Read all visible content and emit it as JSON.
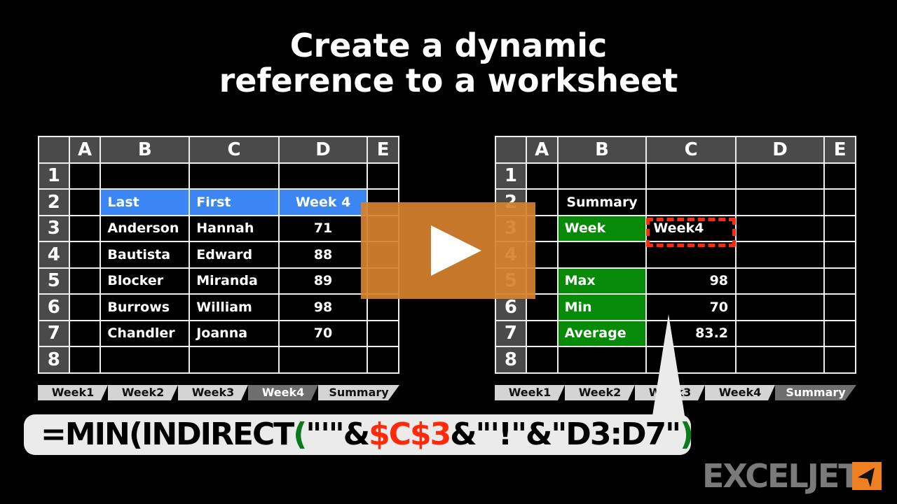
{
  "title": {
    "line1": "Create a dynamic",
    "line2": "reference to a worksheet"
  },
  "left_sheet": {
    "columns": [
      "A",
      "B",
      "C",
      "D",
      "E"
    ],
    "rows": [
      "1",
      "2",
      "3",
      "4",
      "5",
      "6",
      "7",
      "8"
    ],
    "header_row": {
      "last": "Last",
      "first": "First",
      "week": "Week 4"
    },
    "data": [
      {
        "last": "Anderson",
        "first": "Hannah",
        "score": "71"
      },
      {
        "last": "Bautista",
        "first": "Edward",
        "score": "88"
      },
      {
        "last": "Blocker",
        "first": "Miranda",
        "score": "89"
      },
      {
        "last": "Burrows",
        "first": "William",
        "score": "98"
      },
      {
        "last": "Chandler",
        "first": "Joanna",
        "score": "70"
      }
    ],
    "tabs": [
      "Week1",
      "Week2",
      "Week3",
      "Week4",
      "Summary"
    ],
    "active_tab": "Week4"
  },
  "right_sheet": {
    "columns": [
      "A",
      "B",
      "C",
      "D",
      "E"
    ],
    "rows": [
      "1",
      "2",
      "3",
      "4",
      "5",
      "6",
      "7",
      "8"
    ],
    "summary_label": "Summary",
    "week_label": "Week",
    "week_value": "Week4",
    "stats": [
      {
        "label": "Max",
        "value": "98"
      },
      {
        "label": "Min",
        "value": "70"
      },
      {
        "label": "Average",
        "value": "83.2"
      }
    ],
    "tabs": [
      "Week1",
      "Week2",
      "Week3",
      "Week4",
      "Summary"
    ],
    "active_tab": "Summary"
  },
  "formula": {
    "part1": "=MIN(INDIRECT",
    "paren_open": "(",
    "part2": "\"'\"&",
    "ref": "$C$3",
    "part3": "&\"'!\"&\"D3:D7\"",
    "paren_close": ")",
    "part4": ")"
  },
  "play_button": {
    "icon": "play-icon"
  },
  "logo": {
    "text": "EXCELJET",
    "accent": "#f07f22"
  },
  "colors": {
    "header_blue": "#3b86f4",
    "label_green": "#078a07",
    "highlight_red": "#ff2a0a",
    "play_orange": "#d6822d"
  }
}
